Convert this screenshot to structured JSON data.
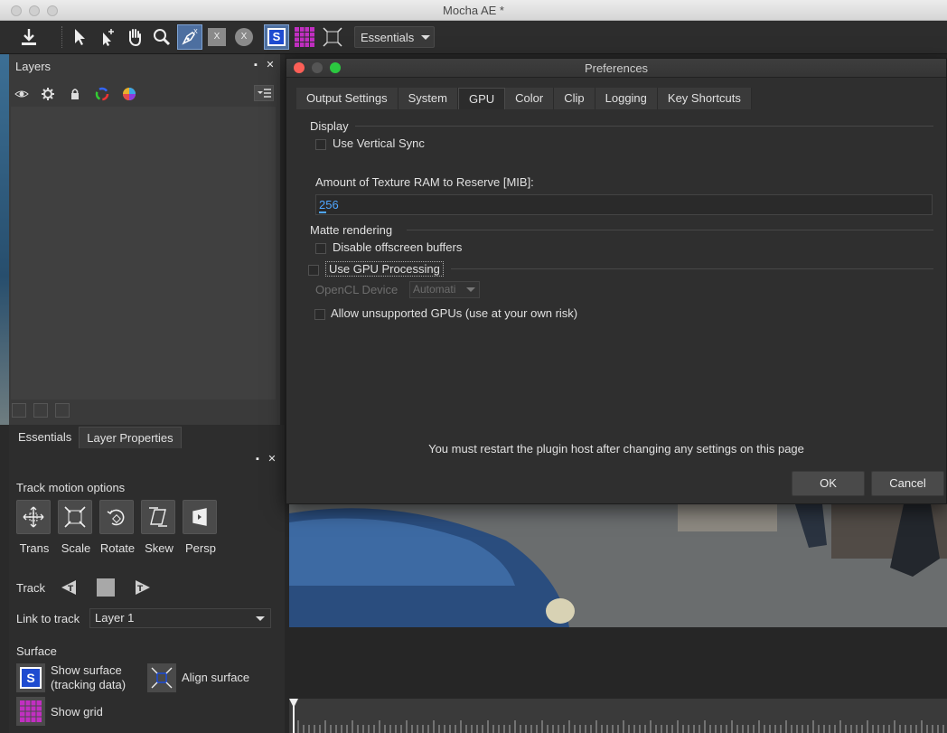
{
  "window": {
    "title": "Mocha AE *"
  },
  "toolbar": {
    "workspace_value": "Essentials",
    "tools": [
      "export-icon",
      "select-icon",
      "add-select-icon",
      "hand-icon",
      "zoom-icon",
      "pen-icon",
      "x-spline-icon",
      "bezier-icon",
      "surface-icon",
      "grid-icon",
      "align-icon"
    ]
  },
  "layers_panel": {
    "title": "Layers",
    "icons": [
      "eye-icon",
      "gear-icon",
      "lock-icon",
      "color-ring-icon",
      "color-wheel-icon"
    ]
  },
  "lower_panel": {
    "tabs": [
      "Essentials",
      "Layer Properties"
    ],
    "track_motion_title": "Track motion options",
    "motion_buttons": [
      "Trans",
      "Scale",
      "Rotate",
      "Skew",
      "Persp"
    ],
    "track_label": "Track",
    "link_label": "Link to track",
    "link_value": "Layer 1",
    "surface_title": "Surface",
    "show_surface": "Show surface",
    "show_surface_sub": "(tracking data)",
    "align_surface": "Align surface",
    "show_grid": "Show grid"
  },
  "dialog": {
    "title": "Preferences",
    "tabs": [
      "Output Settings",
      "System",
      "GPU",
      "Color",
      "Clip",
      "Logging",
      "Key Shortcuts"
    ],
    "selected_tab": "GPU",
    "display_section": "Display",
    "vsync": "Use Vertical Sync",
    "texture_label": "Amount of Texture RAM to Reserve [MIB]:",
    "texture_value": "256",
    "matte_section": "Matte rendering",
    "offscreen": "Disable offscreen buffers",
    "gpu_processing": "Use GPU Processing",
    "opencl_label": "OpenCL Device",
    "opencl_value": "Automati",
    "unsupported": "Allow unsupported GPUs (use at your own risk)",
    "restart_note": "You must restart the plugin host after changing any settings on this page",
    "ok": "OK",
    "cancel": "Cancel"
  },
  "colors": {
    "accent": "#4d6fa0",
    "value_blue": "#4fa6ff",
    "grid_magenta": "#c22fc2"
  }
}
